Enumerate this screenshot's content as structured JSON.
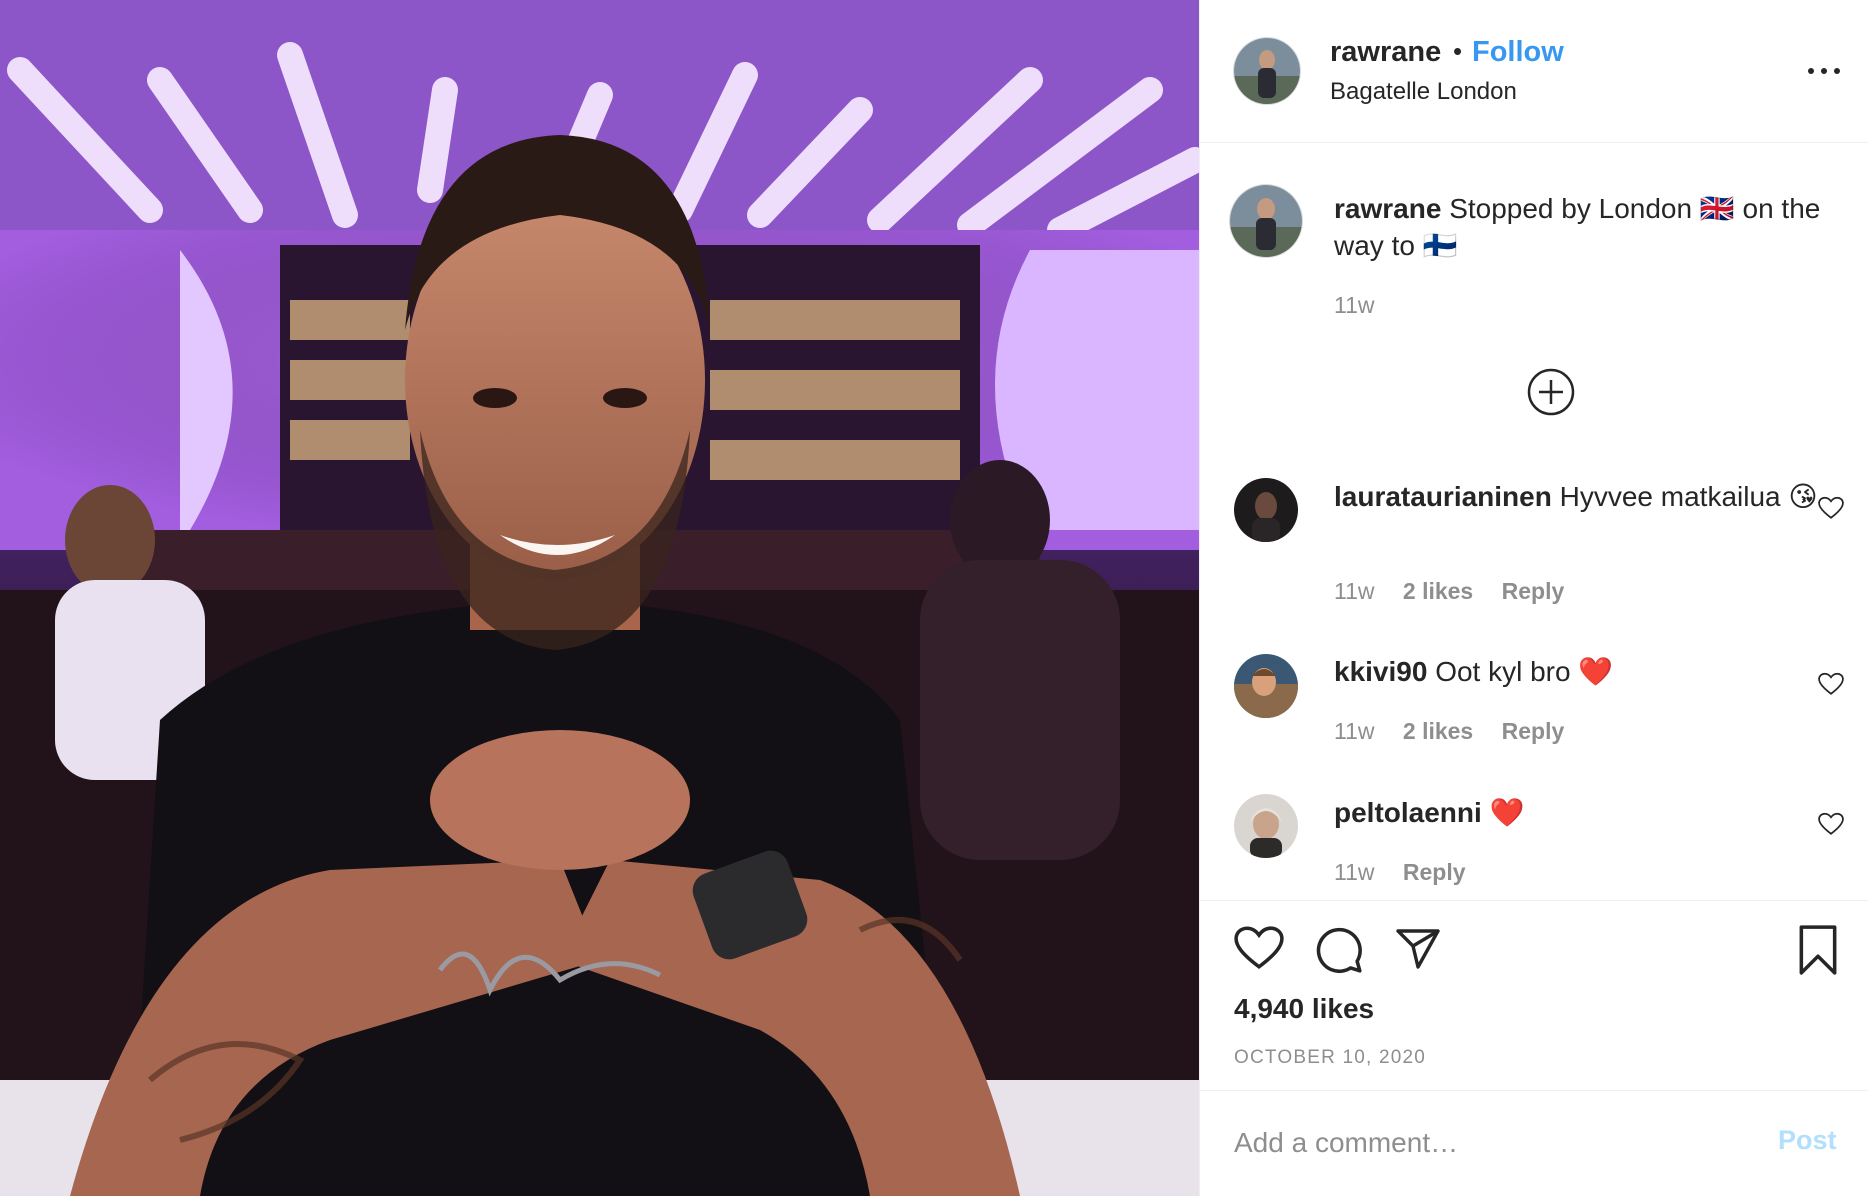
{
  "post": {
    "image_description_icon": "photo",
    "author": {
      "username": "rawrane",
      "separator": "•",
      "follow_label": "Follow",
      "location": "Bagatelle London"
    },
    "caption": {
      "username": "rawrane",
      "text": "Stopped by London 🇬🇧 on the way to 🇫🇮",
      "time": "11w"
    },
    "comments": [
      {
        "username": "laurataurianinen",
        "text": "Hyvvee matkailua 😘",
        "time": "11w",
        "likes": "2 likes",
        "reply": "Reply"
      },
      {
        "username": "kkivi90",
        "text": "Oot kyl bro ❤️",
        "time": "11w",
        "likes": "2 likes",
        "reply": "Reply"
      },
      {
        "username": "peltolaenni",
        "text": "❤️",
        "time": "11w",
        "likes": "",
        "reply": "Reply"
      }
    ],
    "likes_count": "4,940 likes",
    "date": "OCTOBER 10, 2020",
    "comment_box": {
      "placeholder": "Add a comment…",
      "post_label": "Post"
    },
    "colors": {
      "accent": "#3897f0",
      "post_disabled": "#b2dffc",
      "secondary_text": "#8e8e8e"
    }
  }
}
